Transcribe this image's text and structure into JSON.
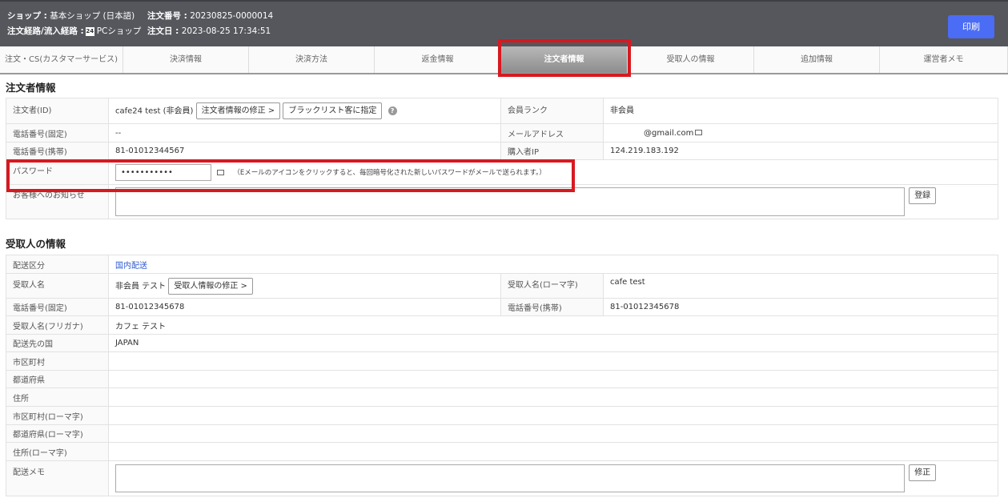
{
  "header": {
    "shop_label": "ショップ :",
    "shop_value": "基本ショップ (日本語)",
    "order_no_label": "注文番号 :",
    "order_no_value": "20230825-0000014",
    "route_label": "注文経路/流入経路 :",
    "route_badge": "24",
    "route_value": "PCショップ",
    "order_date_label": "注文日 :",
    "order_date_value": "2023-08-25 17:34:51",
    "print_label": "印刷"
  },
  "tabs": [
    {
      "label": "注文・CS(カスタマーサービス)",
      "active": false
    },
    {
      "label": "決済情報",
      "active": false
    },
    {
      "label": "決済方法",
      "active": false
    },
    {
      "label": "返金情報",
      "active": false
    },
    {
      "label": "注文者情報",
      "active": true
    },
    {
      "label": "受取人の情報",
      "active": false
    },
    {
      "label": "追加情報",
      "active": false
    },
    {
      "label": "運営者メモ",
      "active": false
    }
  ],
  "orderer": {
    "title": "注文者情報",
    "id_label": "注文者(ID)",
    "id_value": "cafe24 test (非会員)",
    "edit_button": "注文者情報の修正 >",
    "blacklist_button": "ブラックリスト客に指定",
    "help_icon": "?",
    "rank_label": "会員ランク",
    "rank_value": "非会員",
    "tel_label": "電話番号(固定)",
    "tel_value": "--",
    "email_label": "メールアドレス",
    "email_value": "@gmail.com",
    "mobile_label": "電話番号(携帯)",
    "mobile_value": "81-01012344567",
    "ip_label": "購入者IP",
    "ip_value": "124.219.183.192",
    "password_label": "パスワード",
    "password_value": "•••••••••••",
    "password_note": "（Eメールのアイコンをクリックすると、毎回暗号化された新しいパスワードがメールで送られます。）",
    "notice_label": "お客様へのお知らせ",
    "register_button": "登録"
  },
  "recipient": {
    "title": "受取人の情報",
    "delivery_type_label": "配送区分",
    "delivery_type_value": "国内配送",
    "name_label": "受取人名",
    "name_value": "非会員 テスト",
    "edit_button": "受取人情報の修正 >",
    "name_roman_label": "受取人名(ローマ字)",
    "name_roman_value": "cafe test",
    "tel_label": "電話番号(固定)",
    "tel_value": "81-01012345678",
    "mobile_label": "電話番号(携帯)",
    "mobile_value": "81-01012345678",
    "furigana_label": "受取人名(フリガナ)",
    "furigana_value": "カフェ テスト",
    "country_label": "配送先の国",
    "country_value": "JAPAN",
    "city_label": "市区町村",
    "prefecture_label": "都道府県",
    "address_label": "住所",
    "city_roman_label": "市区町村(ローマ字)",
    "prefecture_roman_label": "都道府県(ローマ字)",
    "address_roman_label": "住所(ローマ字)",
    "memo_label": "配送メモ",
    "modify_button": "修正"
  },
  "colors": {
    "header_bg": "#55575d",
    "print_button": "#4b6cf5",
    "highlight": "#d71920",
    "link": "#2f5bd3"
  }
}
